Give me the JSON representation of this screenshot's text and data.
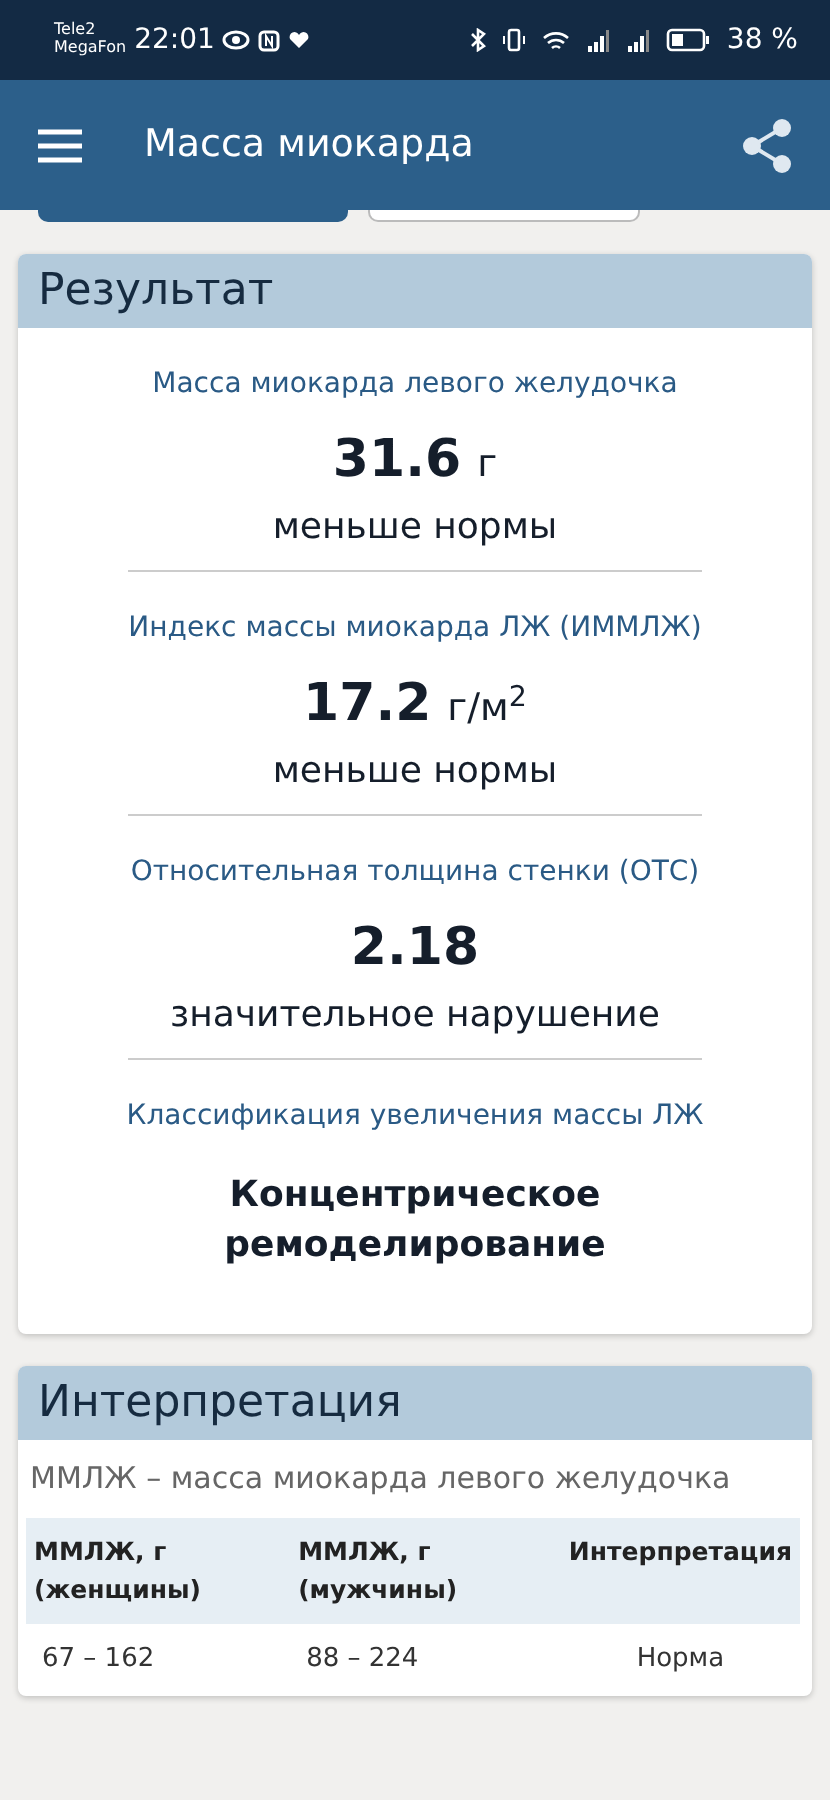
{
  "status_bar": {
    "carrier_1": "Tele2",
    "carrier_2": "MegaFon",
    "time": "22:01",
    "battery": "38 %"
  },
  "app_bar": {
    "title": "Масса миокарда"
  },
  "tabs": [
    {
      "selected": true
    },
    {
      "selected": false
    }
  ],
  "result": {
    "title": "Результат",
    "items": [
      {
        "label": "Масса миокарда левого желудочка",
        "value": "31.6",
        "unit": "г",
        "note": "меньше нормы",
        "kind": "value"
      },
      {
        "label": "Индекс массы миокарда ЛЖ (ИММЛЖ)",
        "value": "17.2",
        "unit": "г/м$^{2}$",
        "note": "меньше нормы",
        "kind": "value"
      },
      {
        "label": "Относительная толщина стенки (ОТС)",
        "value": "2.18",
        "note": "значительное нарушение",
        "kind": "value"
      },
      {
        "label": "Классификация увеличения массы ЛЖ",
        "value": "Концентрическое ремоделирование",
        "kind": "text"
      }
    ]
  },
  "interpretation": {
    "title": "Интерпретация",
    "subtitle": "ММЛЖ – масса миокарда левого желудочка",
    "table": {
      "columns": [
        "ММЛЖ, г (женщины)",
        "ММЛЖ, г (мужчины)",
        "Интерпретация"
      ],
      "rows": [
        [
          "67 – 162",
          "88 – 224",
          "Норма"
        ]
      ]
    }
  }
}
